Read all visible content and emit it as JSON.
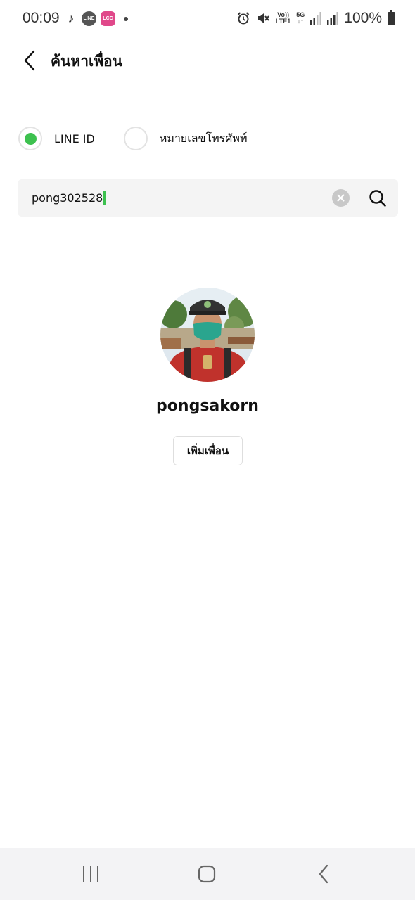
{
  "status_bar": {
    "time": "00:09",
    "notification_icons": [
      "tiktok-icon",
      "line-icon",
      "lcc-icon",
      "dot-icon"
    ],
    "line_icon_text": "LINE",
    "lcc_icon_text": "LCC",
    "volte_label": "Vo))",
    "lte_label": "LTE1",
    "fiveg_label": "5G",
    "battery_percent": "100%"
  },
  "header": {
    "title": "ค้นหาเพื่อน"
  },
  "search_type": {
    "options": [
      {
        "label": "LINE ID",
        "selected": true
      },
      {
        "label": "หมายเลขโทรศัพท์",
        "selected": false
      }
    ]
  },
  "search": {
    "value": "pong302528"
  },
  "result": {
    "name": "pongsakorn",
    "add_button_label": "เพิ่มเพื่อน"
  },
  "colors": {
    "accent": "#3dc14f",
    "search_bg": "#f4f4f4",
    "nav_bg": "#f3f3f5"
  }
}
